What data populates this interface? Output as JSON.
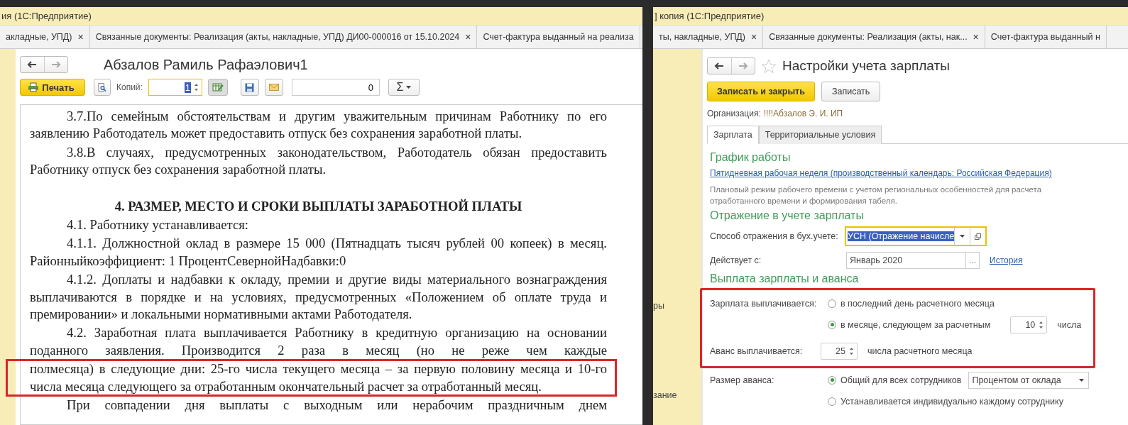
{
  "left_window": {
    "title": "ия  (1С:Предприятие)",
    "tabs": [
      {
        "label": "акладные, УПД)",
        "close": "×"
      },
      {
        "label": "Связанные документы: Реализация (акты, накладные, УПД) ДИ00-000016 от 15.10.2024",
        "close": "×"
      },
      {
        "label": "Счет-фактура выданный на реализа"
      }
    ],
    "document_title": "Абзалов Рамиль Рафаэлович1",
    "toolbar": {
      "print_label": "Печать",
      "copies_label": "Копий:",
      "copies_value": "1",
      "amount_value": "0",
      "sum_label": "Σ"
    },
    "paragraphs": [
      {
        "kind": "paragraph",
        "text": "3.7.По семейным обстоятельствам и другим уважительным причинам Работнику по его заявлению Работодатель может предоставить отпуск без сохранения заработной платы.",
        "highlighted": false
      },
      {
        "kind": "paragraph",
        "text": "3.8.В случаях, предусмотренных законодательством, Работодатель обязан предоставить Работнику отпуск без сохранения заработной платы.",
        "highlighted": false
      },
      {
        "kind": "heading",
        "text": "4. РАЗМЕР, МЕСТО И СРОКИ ВЫПЛАТЫ ЗАРАБОТНОЙ ПЛАТЫ",
        "highlighted": false
      },
      {
        "kind": "paragraph",
        "text": "4.1. Работнику устанавливается:",
        "highlighted": false
      },
      {
        "kind": "paragraph",
        "text": "4.1.1. Должностной оклад в размере 15 000 (Пятнадцать тысяч рублей 00 копеек) в месяц. Районныйкоэффициент: 1 ПроцентСевернойНадбавки:0",
        "highlighted": false
      },
      {
        "kind": "paragraph",
        "text": "4.1.2. Доплаты и надбавки к окладу, премии и другие виды материального вознаграждения выплачиваются в порядке и на условиях, предусмотренных «Положением об оплате труда и премировании» и локальными нормативными актами Работодателя.",
        "highlighted": false
      },
      {
        "kind": "paragraph_start",
        "text": "4.2. Заработная плата выплачивается Работнику в кредитную организацию на основании поданного заявления. Производится 2 раза в месяц (но не реже чем каждые",
        "highlighted": false
      },
      {
        "kind": "continuation",
        "text": "полмесяца) в следующие дни: 25-го числа текущего месяца – за первую половину месяца и 10-го числа месяца следующего за отработанным окончательный расчет за отработанный месяц.",
        "highlighted": true
      },
      {
        "kind": "paragraph_start",
        "text": "При совпадении дня выплаты с выходным или нерабочим праздничным днем",
        "highlighted": false
      }
    ]
  },
  "right_window": {
    "title": "] копия  (1С:Предприятие)",
    "tabs": [
      {
        "label": "ты, накладные, УПД)",
        "close": "×"
      },
      {
        "label": "Связанные документы: Реализация (акты, нак...",
        "close": "×"
      },
      {
        "label": "Счет-фактура выданный н"
      }
    ],
    "sidebar_items": [
      "ры",
      "зание"
    ],
    "form_title": "Настройки учета зарплаты",
    "buttons": [
      {
        "label": "Записать и закрыть",
        "kind": "primary"
      },
      {
        "label": "Записать",
        "kind": "normal"
      }
    ],
    "organization": {
      "label": "Организация:",
      "value": "!!!!Абзалов Э. И. ИП"
    },
    "tabs_inner": [
      {
        "label": "Зарплата",
        "selected": true
      },
      {
        "label": "Территориальные условия",
        "selected": false
      }
    ],
    "schedule": {
      "heading": "График работы",
      "link": "Пятидневная рабочая неделя (производственный календарь: Российская Федерация)",
      "note": "Плановый режим рабочего времени с учетом региональных особенностей для расчета отработанного времени и формирования табеля."
    },
    "accounting": {
      "heading": "Отражение в учете зарплаты",
      "method_label": "Способ отражения в бух.учете:",
      "method_value": "УСН (Отражение начисле",
      "effective_label": "Действует с:",
      "effective_value": "Январь 2020",
      "choose_button": "...",
      "history_link": "История"
    },
    "payment": {
      "heading": "Выплата зарплаты и аванса",
      "highlighted": true,
      "salary_label": "Зарплата выплачивается:",
      "salary_options": [
        {
          "label": "в последний день расчетного месяца",
          "selected": false
        },
        {
          "label": "в месяце, следующем за расчетным",
          "selected": true,
          "day": "10",
          "suffix": "числа"
        }
      ],
      "advance_label": "Аванс выплачивается:",
      "advance_day": "25",
      "advance_suffix": "числа расчетного месяца",
      "advance_size_label": "Размер аванса:",
      "advance_size_options": [
        {
          "label": "Общий для всех сотрудников",
          "selected": true,
          "method": "Процентом от оклада"
        },
        {
          "label": "Устанавливается индивидуально каждому сотруднику",
          "selected": false
        }
      ]
    }
  }
}
